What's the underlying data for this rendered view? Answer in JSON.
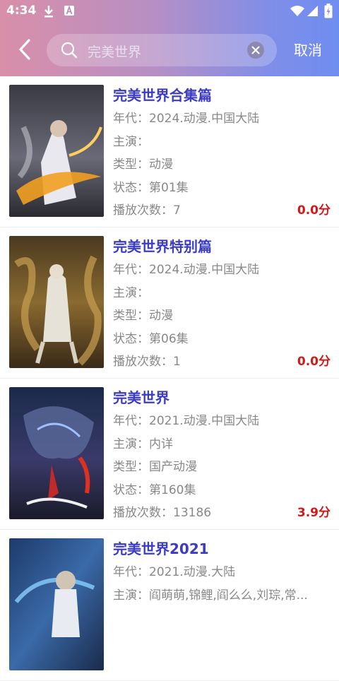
{
  "status": {
    "time": "4:34"
  },
  "search": {
    "query": "完美世界",
    "cancel": "取消"
  },
  "labels": {
    "year": "年代：",
    "cast": "主演：",
    "type": "类型：",
    "state": "状态：",
    "plays": "播放次数："
  },
  "results": [
    {
      "title": "完美世界合集篇",
      "year": "2024.动漫.中国大陆",
      "cast": "",
      "type": "动漫",
      "state": "第01集",
      "plays": "7",
      "score": "0.0分"
    },
    {
      "title": "完美世界特别篇",
      "year": "2024.动漫.中国大陆",
      "cast": "",
      "type": "动漫",
      "state": "第06集",
      "plays": "1",
      "score": "0.0分"
    },
    {
      "title": "完美世界",
      "year": "2021.动漫.中国大陆",
      "cast": "内详",
      "type": "国产动漫",
      "state": "第160集",
      "plays": "13186",
      "score": "3.9分"
    },
    {
      "title": "完美世界2021",
      "year": "2021.动漫.大陆",
      "cast": "阎萌萌,锦鲤,阎么么,刘琮,常...",
      "type": "",
      "state": "",
      "plays": "",
      "score": ""
    }
  ],
  "colors": {
    "title": "#3b3bc8",
    "score": "#d01a1a",
    "gradient_start": "#d98fa8",
    "gradient_end": "#6f8df0"
  },
  "icons": [
    "download-icon",
    "a-notification-icon",
    "wifi-icon",
    "signal-icon",
    "battery-icon",
    "back-arrow-icon",
    "search-icon",
    "clear-icon"
  ]
}
